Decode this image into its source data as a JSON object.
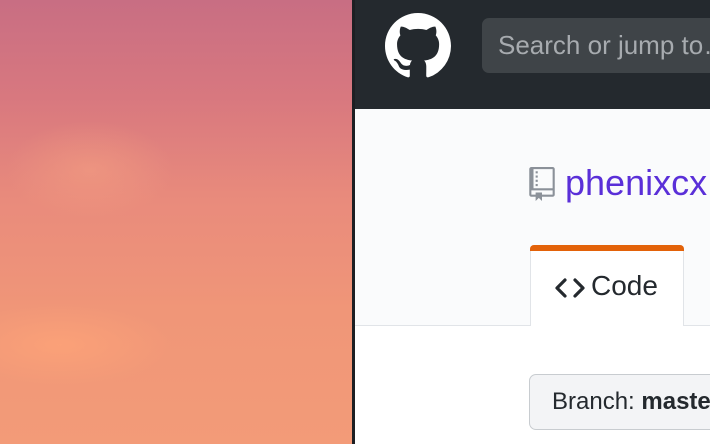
{
  "header": {
    "logo_icon": "github-octocat-icon",
    "search_placeholder": "Search or jump to…"
  },
  "repo": {
    "icon": "repo-icon",
    "owner": "phenixcx"
  },
  "tabs": [
    {
      "label": "Code",
      "icon": "code-brackets-icon",
      "selected": true
    }
  ],
  "branch": {
    "prefix": "Branch:",
    "name": "master"
  },
  "colors": {
    "header_bg": "#24292e",
    "link": "#5a2fd8",
    "tab_accent": "#e36209"
  }
}
